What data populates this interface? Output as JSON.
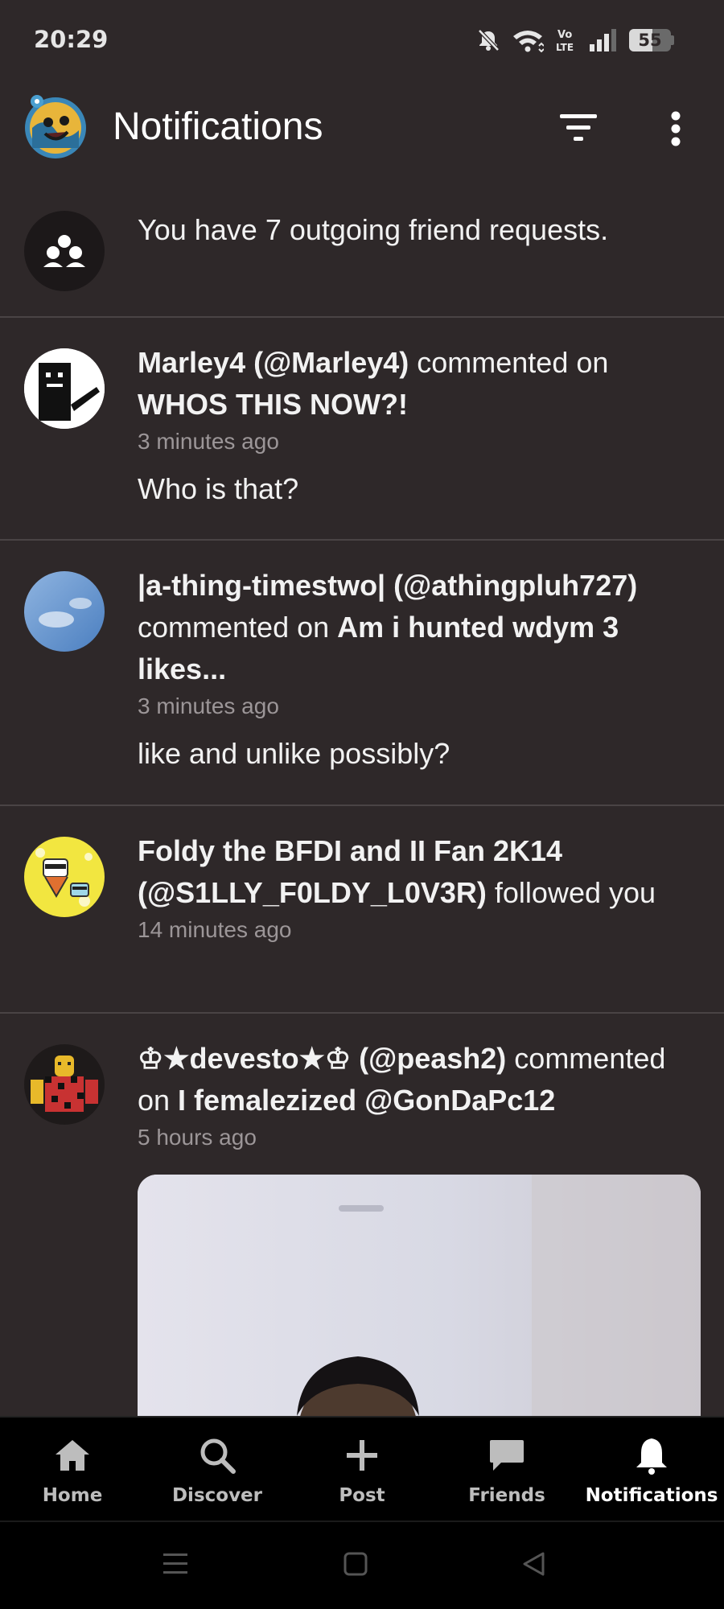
{
  "status_bar": {
    "time": "20:29",
    "battery": "55",
    "battery_level": 0.55
  },
  "header": {
    "title": "Notifications"
  },
  "friend_requests": {
    "text": "You have 7 outgoing friend requests."
  },
  "notifications": [
    {
      "user": "Marley4 (@Marley4)",
      "action": " commented on ",
      "target": "WHOS THIS NOW?!",
      "time": "3 minutes ago",
      "comment": "Who is that?"
    },
    {
      "user": "|a-thing-timestwo| (@athingpluh727)",
      "action": " commented on ",
      "target": "Am i hunted wdym 3 likes...",
      "time": "3 minutes ago",
      "comment": "like and unlike possibly?"
    },
    {
      "user": "Foldy the BFDI and II Fan 2K14 (@S1LLY_F0LDY_L0V3R)",
      "action": " followed you",
      "time": "14 minutes ago"
    },
    {
      "user": "♔★devesto★♔ (@peash2)",
      "action": " commented on ",
      "target": "I femalezized @GonDaPc12",
      "time": "5 hours ago"
    }
  ],
  "bottom_nav": {
    "items": [
      {
        "label": "Home",
        "icon": "home-icon"
      },
      {
        "label": "Discover",
        "icon": "search-icon"
      },
      {
        "label": "Post",
        "icon": "plus-icon"
      },
      {
        "label": "Friends",
        "icon": "chat-icon"
      },
      {
        "label": "Notifications",
        "icon": "bell-icon",
        "active": true
      }
    ]
  },
  "colors": {
    "background": "#2e2829",
    "divider": "#4a4445",
    "nav_background": "#000000",
    "secondary_text": "#9c9698"
  }
}
